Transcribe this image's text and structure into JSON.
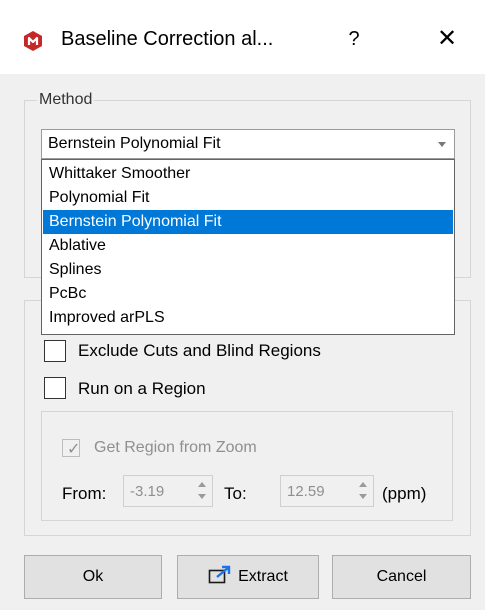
{
  "window": {
    "title": "Baseline Correction al...",
    "help_label": "?",
    "close_label": "✕",
    "icon": "mestrenova-logo-icon",
    "accent_color": "#c62828"
  },
  "method_group": {
    "legend": "Method",
    "selected": "Bernstein Polynomial Fit",
    "options": [
      "Whittaker Smoother",
      "Polynomial Fit",
      "Bernstein Polynomial Fit",
      "Ablative",
      "Splines",
      "PcBc",
      "Improved arPLS"
    ],
    "highlight_color": "#0078d7"
  },
  "options_group": {
    "exclude_label": "Exclude Cuts and Blind Regions",
    "exclude_checked": false,
    "region_label": "Run on a Region",
    "region_checked": false,
    "zoom_label": "Get Region from Zoom",
    "zoom_checked": true,
    "from_label": "From:",
    "from_value": "-3.19",
    "to_label": "To:",
    "to_value": "12.59",
    "unit_label": "(ppm)"
  },
  "buttons": {
    "ok": "Ok",
    "extract": "Extract",
    "cancel": "Cancel"
  }
}
